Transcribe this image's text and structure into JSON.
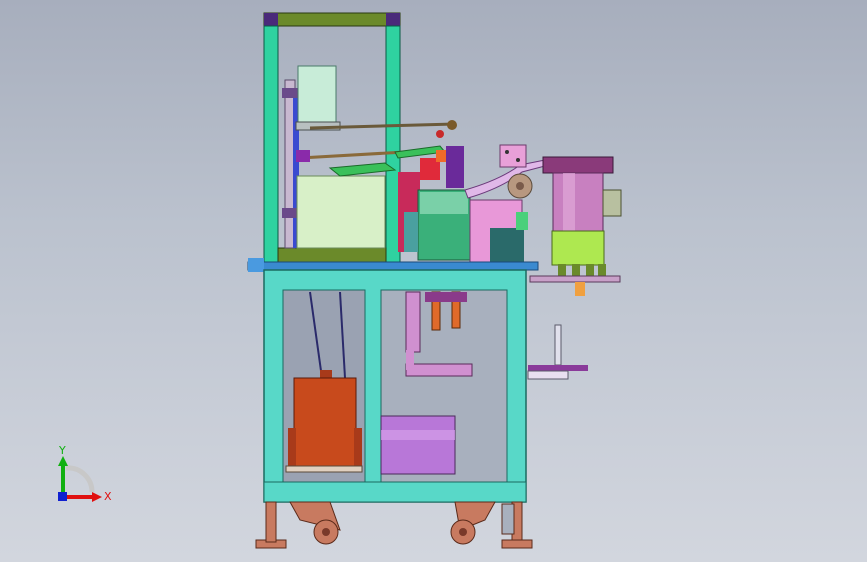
{
  "triad": {
    "x_label": "X",
    "y_label": "Y",
    "x_color": "#e01010",
    "y_color": "#10b010",
    "z_color": "#1020d0"
  },
  "colors": {
    "frame": "#2fd2a0",
    "frame_stroke": "#0a5a44",
    "top_cap": "#6b8a2a",
    "corner": "#4a2a7a",
    "base": "#58d8c8",
    "base_stroke": "#1a6a60",
    "motor": "#c84a1c",
    "drum": "#b877d8",
    "bowl": "#c880c0",
    "bowl_base": "#aee850",
    "pale_box": "#d8f0c8",
    "cylinder": "#c8ecd8",
    "caster": "#c87a60"
  }
}
